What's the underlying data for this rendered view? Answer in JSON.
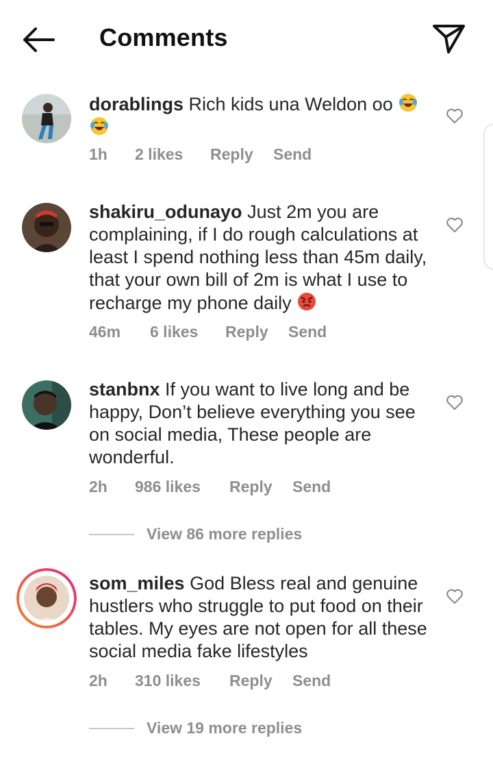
{
  "header": {
    "title": "Comments"
  },
  "comments": [
    {
      "username": "dorablings",
      "text": "Rich kids una Weldon oo",
      "time": "1h",
      "likes": "2 likes",
      "reply": "Reply",
      "send": "Send"
    },
    {
      "username": "shakiru_odunayo",
      "text": "Just 2m you are complaining, if I do rough calculations at least I spend nothing less than 45m daily, that your own bill of 2m is what I use to recharge my phone daily",
      "time": "46m",
      "likes": "6 likes",
      "reply": "Reply",
      "send": "Send"
    },
    {
      "username": "stanbnx",
      "text": "If you want to live long and be happy, Don’t believe everything you see on social media, These people are wonderful.",
      "time": "2h",
      "likes": "986 likes",
      "reply": "Reply",
      "send": "Send",
      "view_replies": "View 86 more replies"
    },
    {
      "username": "som_miles",
      "text": "God Bless real and genuine hustlers who struggle to put food on their tables. My eyes are not open for all these social media fake lifestyles",
      "time": "2h",
      "likes": "310 likes",
      "reply": "Reply",
      "send": "Send",
      "view_replies": "View 19 more replies"
    }
  ],
  "icons": {
    "back": "arrow-left-icon",
    "share": "paper-plane-icon",
    "like": "heart-icon",
    "laugh": "tears-of-joy-emoji",
    "angry": "angry-face-emoji"
  },
  "colors": {
    "text": "#262626",
    "meta": "#8e8e8e",
    "story_ring_start": "#f58529",
    "story_ring_end": "#dd2a7b"
  }
}
